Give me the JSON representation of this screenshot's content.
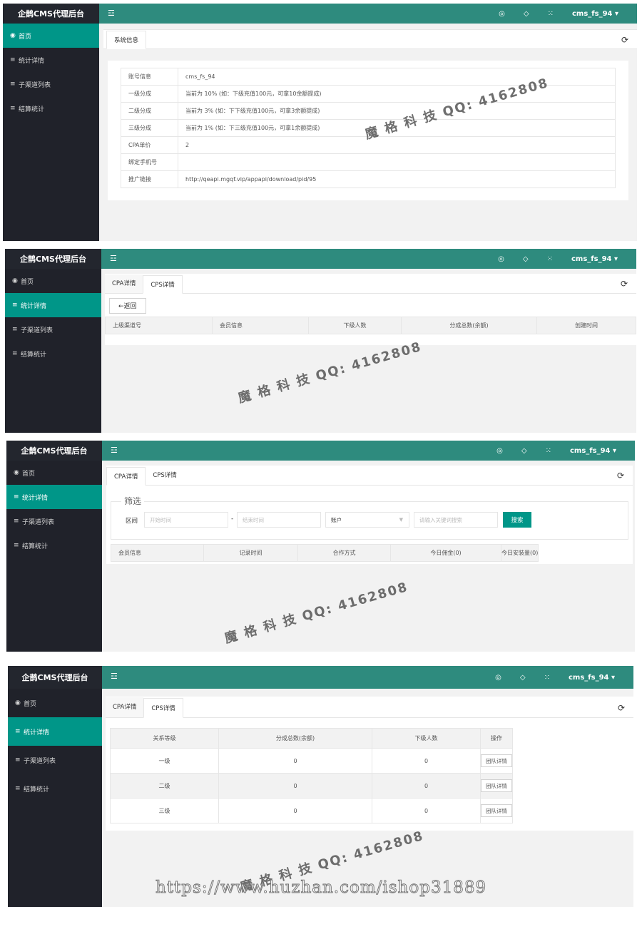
{
  "app": {
    "title": "企鹊CMS代理后台",
    "fold_icon": "☲",
    "tool_icons": [
      "palette-icon",
      "tag-icon",
      "fullscreen-icon"
    ],
    "user": "cms_fs_94 ▾"
  },
  "nav": {
    "home": "首页",
    "stats": "统计详情",
    "channels": "子渠道列表",
    "settle": "结算统计"
  },
  "colors": {
    "accent": "#009688",
    "topbar": "#2e8b7e",
    "sidebar": "#20222a"
  },
  "panel1": {
    "tab": "系统信息",
    "rows": [
      {
        "label": "账号信息",
        "value": "cms_fs_94"
      },
      {
        "label": "一级分成",
        "value": "当前为 10% (如：下级充值100元，可拿10余额提成)"
      },
      {
        "label": "二级分成",
        "value": "当前为 3% (如：下下级充值100元，可拿3余额提成)"
      },
      {
        "label": "三级分成",
        "value": "当前为 1% (如：下三级充值100元，可拿1余额提成)"
      },
      {
        "label": "CPA单价",
        "value": "2"
      },
      {
        "label": "绑定手机号",
        "value": ""
      },
      {
        "label": "推广链接",
        "value": "http://qeapi.mgqf.vip/appapi/download/pid/95"
      }
    ]
  },
  "panel2": {
    "tabs": [
      "CPA详情",
      "CPS详情"
    ],
    "back": "←返回",
    "headers": [
      "上级渠道号",
      "会员信息",
      "下级人数",
      "分成总数(余额)",
      "创建时间"
    ]
  },
  "panel3": {
    "tabs": [
      "CPA详情",
      "CPS详情"
    ],
    "filter_legend": "筛选",
    "range_label": "区间",
    "start_placeholder": "开始时间",
    "dash": "-",
    "end_placeholder": "结束时间",
    "account_select": "账户",
    "keyword_placeholder": "请输入关键词搜索",
    "search": "搜索",
    "headers": [
      "会员信息",
      "记录时间",
      "合作方式",
      "今日佣金(0)",
      "今日安装量(0)"
    ]
  },
  "panel4": {
    "tabs": [
      "CPA详情",
      "CPS详情"
    ],
    "headers": [
      "关系等级",
      "分成总数(余额)",
      "下级人数",
      "操作"
    ],
    "rows": [
      {
        "level": "一级",
        "total": "0",
        "count": "0",
        "action": "团队详情"
      },
      {
        "level": "二级",
        "total": "0",
        "count": "0",
        "action": "团队详情"
      },
      {
        "level": "三级",
        "total": "0",
        "count": "0",
        "action": "团队详情"
      }
    ]
  },
  "watermark": "魔 格 科 技 QQ: 4162808",
  "site_mark": "https://www.huzhan.com/ishop31889"
}
